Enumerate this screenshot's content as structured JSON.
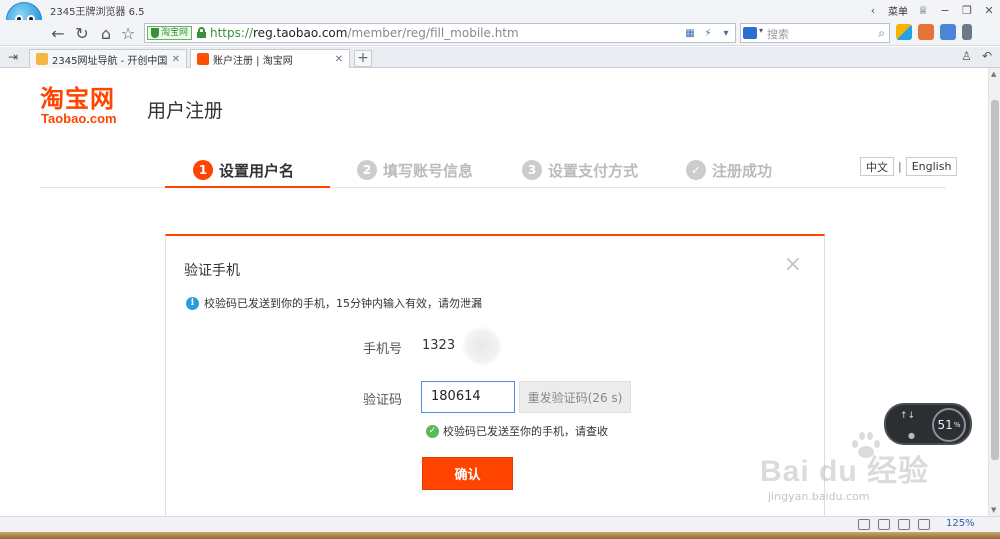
{
  "browser": {
    "app_title": "2345王牌浏览器 6.5",
    "menu_label": "菜单",
    "url": {
      "scheme": "https://",
      "host": "reg.taobao.com",
      "path": "/member/reg/fill_mobile.htm",
      "secure_label": "淘宝网"
    },
    "search_placeholder": "搜索",
    "tabs": [
      {
        "label": "2345网址导航 - 开创中国百年品牌",
        "active": false
      },
      {
        "label": "账户注册 | 淘宝网",
        "active": true
      }
    ],
    "zoom": "125%"
  },
  "page": {
    "logo_cn": "淘宝网",
    "logo_en": "Taobao.com",
    "title": "用户注册",
    "steps": [
      {
        "num": "1",
        "label": "设置用户名",
        "active": true
      },
      {
        "num": "2",
        "label": "填写账号信息",
        "active": false
      },
      {
        "num": "3",
        "label": "设置支付方式",
        "active": false
      },
      {
        "num": "✓",
        "label": "注册成功",
        "active": false
      }
    ],
    "lang": {
      "zh": "中文",
      "sep": "|",
      "en": "English"
    }
  },
  "dialog": {
    "title": "验证手机",
    "close": "×",
    "info": "校验码已发送到你的手机，15分钟内输入有效，请勿泄漏",
    "phone_label": "手机号",
    "phone_value": "1323",
    "code_label": "验证码",
    "code_value": "180614",
    "resend_label": "重发验证码(26 s)",
    "success_msg": "校验码已发送至你的手机，请查收",
    "confirm_label": "确认"
  },
  "overlay": {
    "watermark_main": "Bai du 经验",
    "watermark_sub": "jingyan.baidu.com",
    "speed_percent": "51",
    "speed_unit": "%"
  },
  "colors": {
    "brand": "#ff4400",
    "input_focus": "#4a90d9",
    "success": "#5cb85c",
    "info": "#2b9be0"
  }
}
